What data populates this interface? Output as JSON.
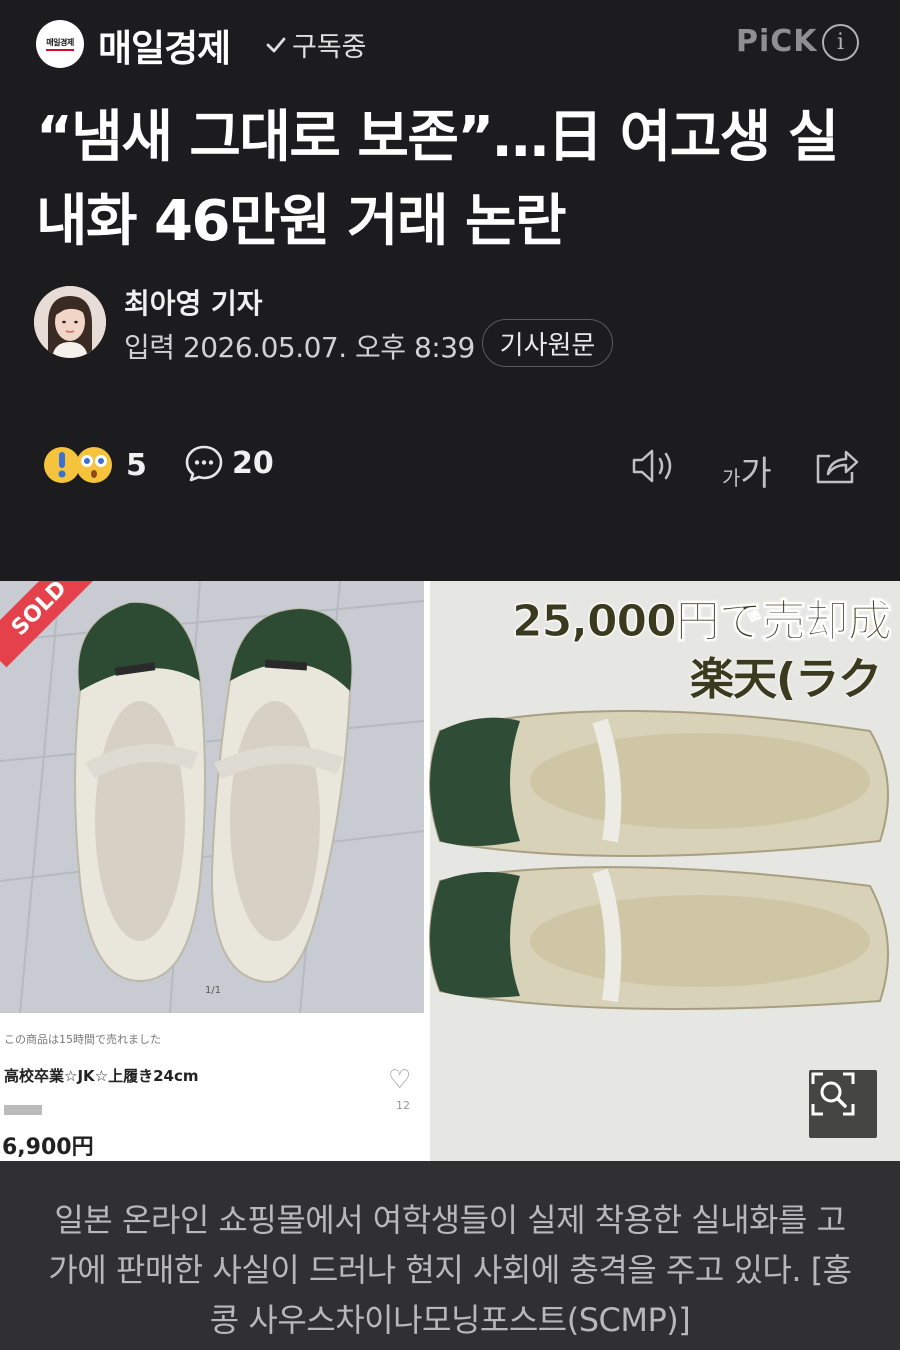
{
  "header": {
    "logo_text": "매일경제",
    "press_name": "매일경제",
    "subscribe_label": "구독중",
    "pick_label": "PiCK",
    "info_icon": "info-icon"
  },
  "article": {
    "headline": "“냄새 그대로 보존”…日 여고생 실내화 46만원 거래 논란",
    "reporter": "최아영 기자",
    "date": "입력 2026.05.07. 오후 8:39",
    "original_button": "기사원문"
  },
  "stats": {
    "reaction_count": "5",
    "comment_count": "20",
    "font_size_small": "가",
    "font_size_large": "가"
  },
  "photo": {
    "sold_badge": "SOLD",
    "pager": "1/1",
    "listing_note": "この商品は15時間で売れました",
    "listing_title": "高校卒業☆JK☆上履き24cm",
    "listing_price": "6,900円",
    "listing_likes": "12",
    "jp_text_1": "25,000円で売却成",
    "jp_text_2": "楽天(ラク"
  },
  "caption": "일본 온라인 쇼핑몰에서 여학생들이 실제 착용한 실내화를 고가에 판매한 사실이 드러나 현지 사회에 충격을 주고 있다. [홍콩 사우스차이나모닝포스트(SCMP)]",
  "colors": {
    "background": "#1c1c1e",
    "caption_bg": "#303033",
    "sold_red": "#e4414b"
  }
}
